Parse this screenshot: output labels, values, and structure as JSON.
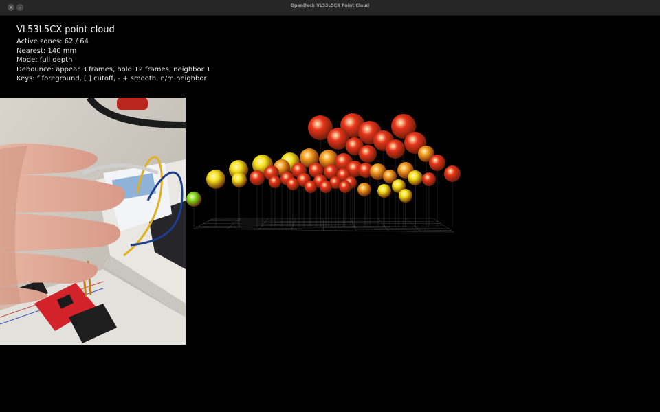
{
  "window": {
    "title": "OpenDeck VL53L5CX Point Cloud",
    "close_glyph": "×",
    "minimize_glyph": "–"
  },
  "hud": {
    "title": "VL53L5CX point cloud",
    "lines": [
      "Active zones: 62 / 64",
      "Nearest: 140 mm",
      "Mode: full depth",
      "Debounce: appear 3 frames, hold 12 frames, neighbor 1",
      "Keys: f foreground, [ ] cutoff, - + smooth, n/m neighbor"
    ]
  },
  "camera": {
    "description_icon": "camera-feed-hand-over-sensor-board"
  },
  "colors": {
    "near": "#7ee01e",
    "mid": "#f5e21b",
    "far": "#e8341a",
    "grid": "#9a9a9a"
  }
}
